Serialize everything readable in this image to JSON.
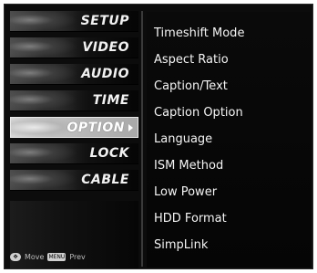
{
  "menu": {
    "items": [
      {
        "label": "SETUP"
      },
      {
        "label": "VIDEO"
      },
      {
        "label": "AUDIO"
      },
      {
        "label": "TIME"
      },
      {
        "label": "OPTION"
      },
      {
        "label": "LOCK"
      },
      {
        "label": "CABLE"
      }
    ],
    "selected_index": 4
  },
  "footer": {
    "move_icon": "dpad-icon",
    "move_label": "Move",
    "prev_button": "MENU",
    "prev_label": "Prev"
  },
  "submenu": {
    "options": [
      {
        "label": "Timeshift Mode"
      },
      {
        "label": "Aspect Ratio"
      },
      {
        "label": "Caption/Text"
      },
      {
        "label": "Caption Option"
      },
      {
        "label": "Language"
      },
      {
        "label": "ISM Method"
      },
      {
        "label": "Low Power"
      },
      {
        "label": "HDD Format"
      },
      {
        "label": "SimpLink"
      }
    ]
  },
  "colors": {
    "background": "#0c0c0c",
    "text": "#f4f4f4",
    "selected_bg": "#bdbdbd"
  }
}
